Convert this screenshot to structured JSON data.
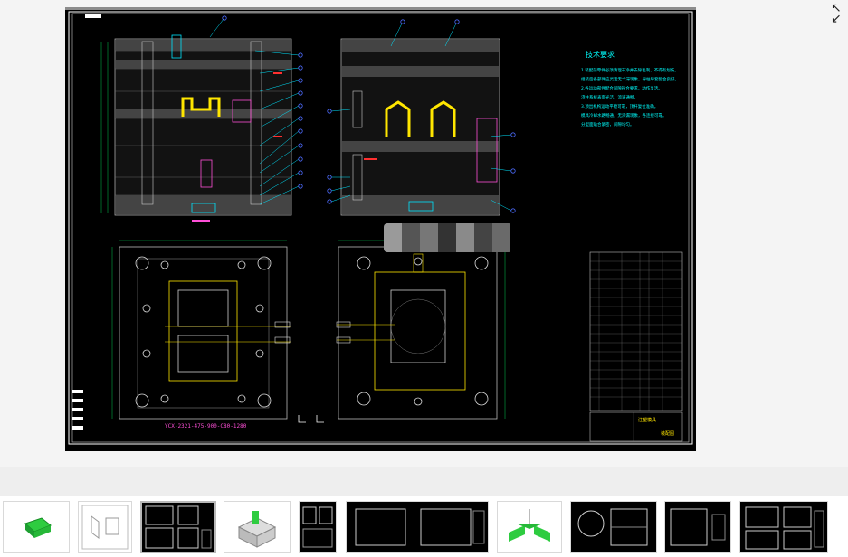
{
  "viewer": {
    "main_image_icon": "cad-mold-drawing",
    "fullscreen_icon": "fullscreen-expand-icon"
  },
  "drawing": {
    "tech_title": "技术要求",
    "tech_lines": [
      "1.装配前零件必须清理干净并去除毛刺，不得有划伤。",
      "组装后各部件应灵活无卡滞现象，导柱导套配合良好。",
      "2.各运动部件配合间隙符合要求，动作灵活。",
      "浇注系统表面光洁，流道通畅。",
      "3.顶出机构运动平稳可靠，顶杆复位准确。",
      "模具冷却水路畅通，无渗漏现象，各连接可靠。",
      "分型面贴合紧密，间隙均匀。"
    ],
    "bottom_label": "YCX-2321-475-900-C80-1280",
    "title_block_name": "注塑模具",
    "title_block_sub": "装配图"
  },
  "thumbnails": [
    {
      "name": "thumb-3d-part",
      "kind": "3d-green"
    },
    {
      "name": "thumb-white-sheet",
      "kind": "white"
    },
    {
      "name": "thumb-assembly-drawing",
      "kind": "dark"
    },
    {
      "name": "thumb-3d-mold",
      "kind": "3d-mold"
    },
    {
      "name": "thumb-drawing-5",
      "kind": "dark"
    },
    {
      "name": "thumb-drawing-6",
      "kind": "dark"
    },
    {
      "name": "thumb-3d-part-2",
      "kind": "3d-green"
    },
    {
      "name": "thumb-drawing-8",
      "kind": "dark"
    },
    {
      "name": "thumb-drawing-9",
      "kind": "dark"
    },
    {
      "name": "thumb-drawing-10",
      "kind": "dark"
    }
  ]
}
